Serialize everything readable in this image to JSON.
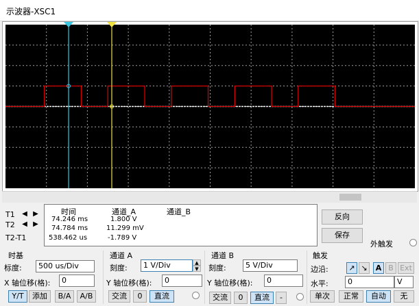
{
  "window": {
    "title": "示波器-XSC1"
  },
  "scope": {
    "background": "#000000",
    "grid_color": "#a0a0a0",
    "trace_a_color": "#d40000",
    "trace_b_color": "#ffffff",
    "cursor1_color": "#38c6e0",
    "cursor2_color": "#f0e040"
  },
  "chart_data": {
    "type": "line",
    "series": [
      {
        "channel": "A",
        "color": "#d40000",
        "shape": "square-wave",
        "high_div": 1,
        "low_div": 0,
        "edges_div": [
          0.95,
          1.85,
          2.5,
          3.4,
          4.05,
          4.95,
          5.6,
          6.5,
          7.15,
          8.05
        ]
      },
      {
        "channel": "B",
        "color": "#ffffff",
        "shape": "flat",
        "level_div": 0
      }
    ],
    "xlim_div": [
      0,
      10
    ],
    "ylim_div": [
      -4,
      4
    ],
    "grid": true
  },
  "readout": {
    "headers": {
      "time": "时间",
      "ch_a": "通道_A",
      "ch_b": "通道_B"
    },
    "rows": [
      {
        "label": "T1",
        "time": "74.246 ms",
        "ch_a": "1.800 V",
        "ch_b": ""
      },
      {
        "label": "T2",
        "time": "74.784 ms",
        "ch_a": "11.299 mV",
        "ch_b": ""
      },
      {
        "label": "T2-T1",
        "time": "538.462 us",
        "ch_a": "-1.789 V",
        "ch_b": ""
      }
    ]
  },
  "buttons": {
    "reverse": "反向",
    "save": "保存",
    "ext_trigger": "外触发"
  },
  "timebase": {
    "title": "时基",
    "scale_label": "标度:",
    "scale_value": "500 us/Div",
    "xpos_label": "X 轴位移(格):",
    "xpos_value": "0",
    "modes": [
      "Y/T",
      "添加",
      "B/A",
      "A/B"
    ]
  },
  "channel_a": {
    "title": "通道 A",
    "scale_label": "刻度:",
    "scale_value": "1  V/Div",
    "ypos_label": "Y 轴位移(格):",
    "ypos_value": "0",
    "coupling": [
      "交流",
      "0",
      "直流"
    ]
  },
  "channel_b": {
    "title": "通道 B",
    "scale_label": "刻度:",
    "scale_value": "5  V/Div",
    "ypos_label": "Y 轴位移(格):",
    "ypos_value": "0",
    "coupling": [
      "交流",
      "0",
      "直流",
      "-"
    ]
  },
  "trigger": {
    "title": "触发",
    "edge_label": "边沿:",
    "edges": [
      "↗",
      "↘"
    ],
    "sources": [
      "A",
      "B",
      "Ext"
    ],
    "level_label": "水平:",
    "level_value": "0",
    "level_unit": "V",
    "modes": [
      "单次",
      "正常",
      "自动",
      "无"
    ]
  }
}
